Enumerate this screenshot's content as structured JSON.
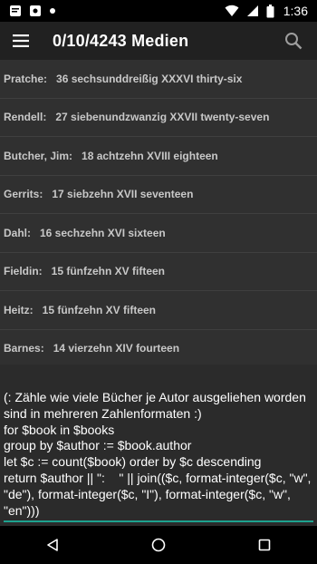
{
  "status": {
    "time": "1:36"
  },
  "appbar": {
    "title": "0/10/4243 Medien"
  },
  "results": [
    {
      "author": "Pratche:",
      "text": "36 sechsunddreißig XXXVI thirty-six"
    },
    {
      "author": "Rendell:",
      "text": "27 siebenundzwanzig XXVII twenty-seven"
    },
    {
      "author": "Butcher, Jim:",
      "text": "18 achtzehn XVIII eighteen"
    },
    {
      "author": "Gerrits:",
      "text": "17 siebzehn XVII seventeen"
    },
    {
      "author": "Dahl:",
      "text": "16 sechzehn XVI sixteen"
    },
    {
      "author": "Fieldin:",
      "text": "15 fünfzehn XV fifteen"
    },
    {
      "author": "Heitz:",
      "text": "15 fünfzehn XV fifteen"
    },
    {
      "author": "Barnes:",
      "text": "14 vierzehn XIV fourteen"
    }
  ],
  "query": "(: Zähle wie viele Bücher je Autor ausgeliehen worden sind in mehreren Zahlenformaten :)\nfor $book in $books\ngroup by $author := $book.author\nlet $c := count($book) order by $c descending\nreturn $author || \":    \" || join(($c, format-integer($c, \"w\", \"de\"), format-integer($c, \"I\"), format-integer($c, \"w\", \"en\")))",
  "icons": {
    "status_left": [
      "message-icon",
      "app-icon",
      "notification-dot-icon"
    ],
    "status_right": [
      "wifi-icon",
      "signal-icon",
      "battery-icon"
    ],
    "menu": "hamburger-menu-icon",
    "search": "search-icon",
    "nav": [
      "back-icon",
      "home-icon",
      "recents-icon"
    ]
  },
  "colors": {
    "accent": "#1ea28f",
    "appbar": "#212121",
    "background": "#303030"
  }
}
